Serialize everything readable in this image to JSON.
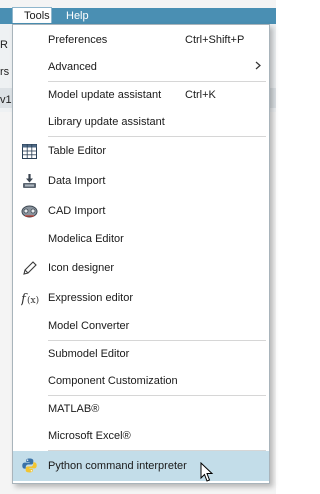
{
  "menubar": {
    "tools": "Tools",
    "help": "Help"
  },
  "background": {
    "frag_r": "R",
    "frag_rs": "rs",
    "frag_v1": "v1"
  },
  "menu": {
    "preferences": {
      "label": "Preferences",
      "shortcut": "Ctrl+Shift+P"
    },
    "advanced": {
      "label": "Advanced",
      "submenu_icon": "chevron-right"
    },
    "model_update": {
      "label": "Model update assistant",
      "shortcut": "Ctrl+K"
    },
    "library_update": {
      "label": "Library update assistant"
    },
    "table_editor": {
      "label": "Table Editor",
      "icon": "table-grid"
    },
    "data_import": {
      "label": "Data Import",
      "icon": "import"
    },
    "cad_import": {
      "label": "CAD Import",
      "icon": "cad"
    },
    "modelica_editor": {
      "label": "Modelica Editor"
    },
    "icon_designer": {
      "label": "Icon designer",
      "icon": "pencil"
    },
    "expression_editor": {
      "label": "Expression editor",
      "icon": "function"
    },
    "model_converter": {
      "label": "Model Converter"
    },
    "submodel_editor": {
      "label": "Submodel Editor"
    },
    "component_customization": {
      "label": "Component Customization"
    },
    "matlab": {
      "label": "MATLAB®"
    },
    "excel": {
      "label": "Microsoft Excel®"
    },
    "python": {
      "label": "Python command interpreter",
      "icon": "python",
      "highlighted": true
    }
  },
  "colors": {
    "menubar": "#4a8fb3",
    "highlight": "#c3dde9"
  }
}
